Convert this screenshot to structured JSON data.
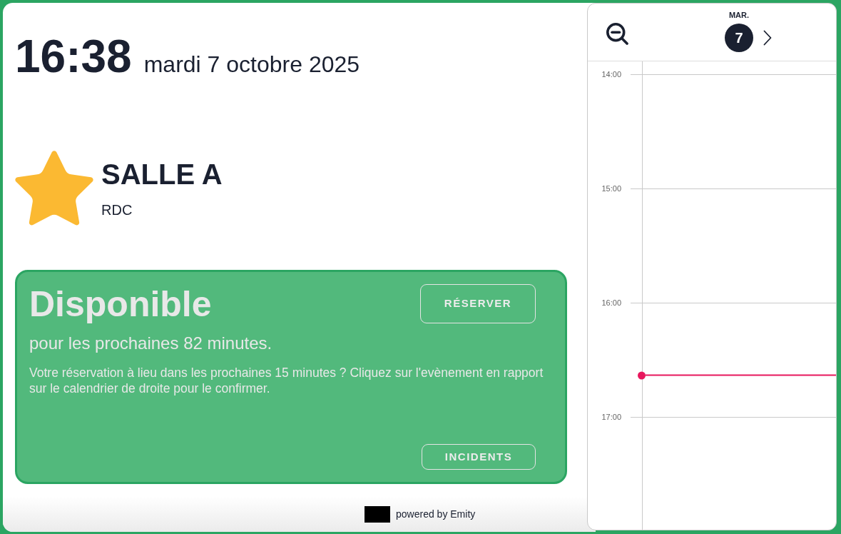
{
  "clock": {
    "time": "16:38",
    "date": "mardi 7 octobre 2025"
  },
  "room": {
    "name": "SALLE A",
    "floor": "RDC"
  },
  "status": {
    "kind": "available",
    "title": "Disponible",
    "subtitle": "pour les prochaines 82 minutes.",
    "note": "Votre réservation à lieu dans les prochaines 15 minutes ? Cliquez sur l'evènement en rapport sur le calendrier de droite pour le confirmer.",
    "primary_action": "RÉSERVER",
    "secondary_action": "INCIDENTS"
  },
  "footer": {
    "text": "powered by Emity"
  },
  "calendar": {
    "day": {
      "weekday": "MAR.",
      "number": "7",
      "today": true
    },
    "slots": [
      {
        "label": "14:00"
      },
      {
        "label": "15:00"
      },
      {
        "label": "16:00"
      },
      {
        "label": "17:00"
      }
    ]
  }
}
